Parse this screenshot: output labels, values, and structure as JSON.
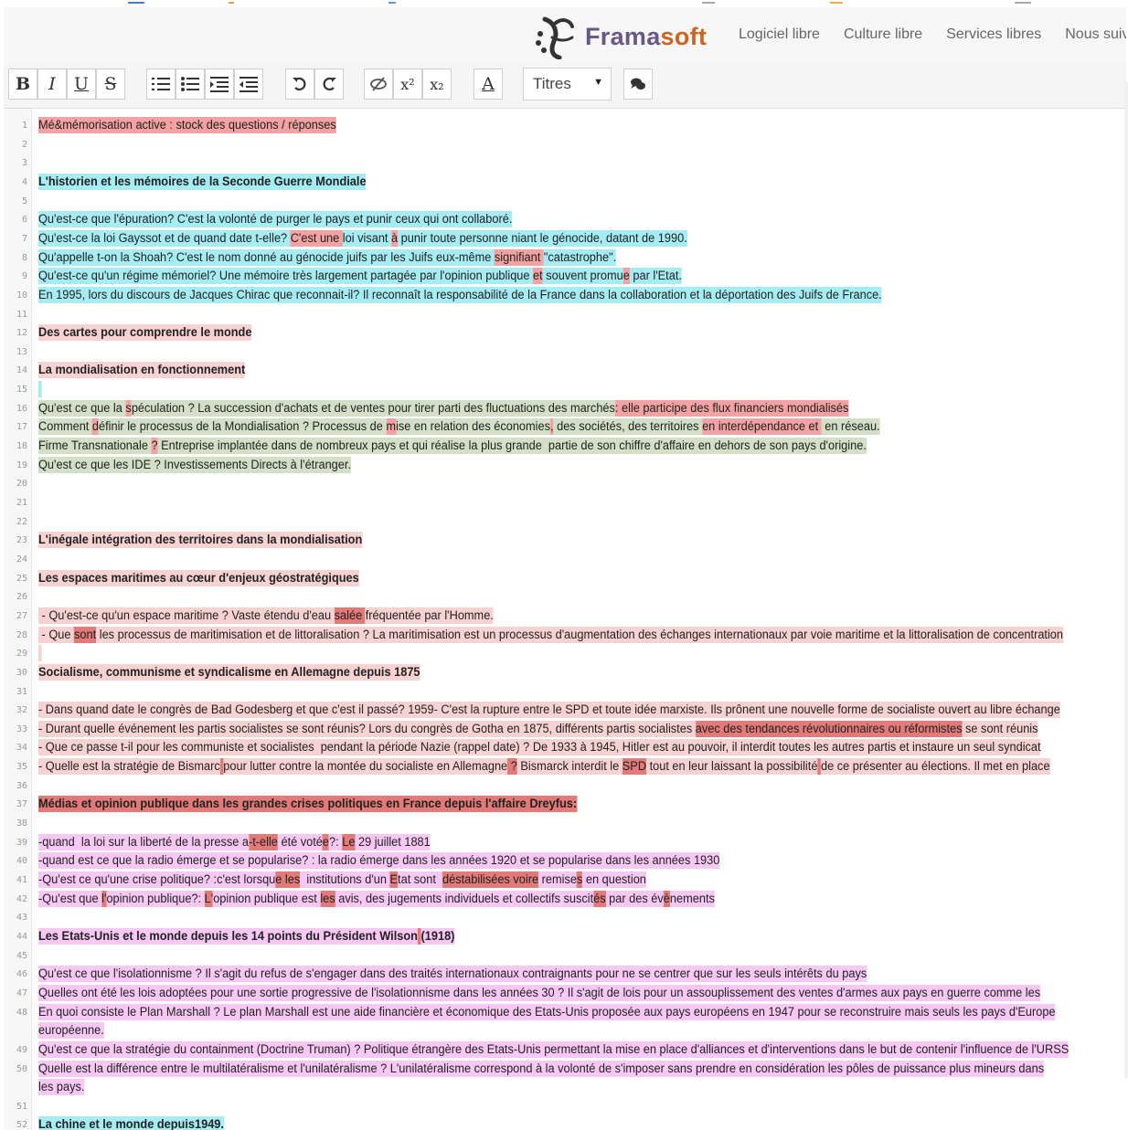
{
  "colors": {
    "blue": "#a6ecf3",
    "red": "#f2a2a2",
    "darkred": "#e27a7a",
    "green": "#d3dfc6",
    "lightpink": "#f7d2d2",
    "pink": "#f6c8f3",
    "accent_purple": "#6a5687",
    "accent_orange": "#cc6520"
  },
  "header": {
    "brand_part1": "Frama",
    "brand_part2": "soft",
    "logo_icon": "framasoft-logo-icon",
    "nav": [
      "Logiciel libre",
      "Culture libre",
      "Services libres",
      "Nous suivre"
    ]
  },
  "toolbar": {
    "buttons": [
      "B",
      "I",
      "U",
      "S",
      "ordered-list",
      "bullet-list",
      "indent",
      "outdent",
      "undo",
      "redo",
      "clear-format",
      "x²",
      "x₂",
      "A"
    ],
    "select_value": "Titres",
    "chat_icon": "chat-icon"
  },
  "lines": [
    {
      "n": "1",
      "segs": [
        {
          "t": "Mé&mémorisation active : stock des questions / réponses",
          "c": "red"
        }
      ]
    },
    {
      "n": "2",
      "segs": []
    },
    {
      "n": "3",
      "segs": []
    },
    {
      "n": "4",
      "segs": [
        {
          "t": "L'historien et les mémoires de la Seconde Guerre Mondiale",
          "c": "blue",
          "b": true
        }
      ]
    },
    {
      "n": "5",
      "segs": []
    },
    {
      "n": "6",
      "segs": [
        {
          "t": "Qu'est-ce que l'épuration? C'est la volonté de purger le pays et punir ceux qui ont collaboré.",
          "c": "blue"
        }
      ]
    },
    {
      "n": "7",
      "segs": [
        {
          "t": "Qu'est-ce la loi Gayssot et de quand date t-elle? ",
          "c": "blue"
        },
        {
          "t": "C'est une ",
          "c": "red"
        },
        {
          "t": "loi visant ",
          "c": "blue"
        },
        {
          "t": "à",
          "c": "red"
        },
        {
          "t": " punir toute personne niant le génocide, datant de 1990.",
          "c": "blue"
        }
      ]
    },
    {
      "n": "8",
      "segs": [
        {
          "t": "Qu'appelle t-on la Shoah? C'est le nom donné au génocide juifs par les Juifs eux-même ",
          "c": "blue"
        },
        {
          "t": "signifiant ",
          "c": "red"
        },
        {
          "t": "\"catastrophe\".",
          "c": "blue"
        }
      ]
    },
    {
      "n": "9",
      "segs": [
        {
          "t": "Qu'est-ce qu'un régime mémoriel? Une mémoire très largement partagée par l'opinion publique ",
          "c": "blue"
        },
        {
          "t": "et",
          "c": "red"
        },
        {
          "t": " souvent promu",
          "c": "blue"
        },
        {
          "t": "e",
          "c": "red"
        },
        {
          "t": " par l'Etat.",
          "c": "blue"
        }
      ]
    },
    {
      "n": "10",
      "segs": [
        {
          "t": "En 1995, lors du discours de Jacques Chirac que reconnait-il? Il reconnaît la responsabilité de la France dans la collaboration et la déportation des Juifs de France.",
          "c": "blue"
        }
      ]
    },
    {
      "n": "11",
      "segs": []
    },
    {
      "n": "12",
      "segs": [
        {
          "t": "Des cartes pour comprendre le monde",
          "c": "lightpink",
          "b": true
        }
      ]
    },
    {
      "n": "13",
      "segs": []
    },
    {
      "n": "14",
      "segs": [
        {
          "t": "La mondialisation en fonctionnement",
          "c": "lightpink",
          "b": true
        }
      ]
    },
    {
      "n": "15",
      "segs": [
        {
          "t": " ",
          "c": "blue"
        }
      ]
    },
    {
      "n": "16",
      "segs": [
        {
          "t": "Qu'est ce que la ",
          "c": "green"
        },
        {
          "t": "s",
          "c": "red"
        },
        {
          "t": "péculation ? La succession d'achats et de ventes pour tirer parti des fluctuations des marchés",
          "c": "green"
        },
        {
          "t": ": elle participe des flux financiers mondialisés",
          "c": "red"
        }
      ]
    },
    {
      "n": "17",
      "segs": [
        {
          "t": "Comment ",
          "c": "green"
        },
        {
          "t": "d",
          "c": "red"
        },
        {
          "t": "éfinir le processus de la Mondialisation ? Processus de ",
          "c": "green"
        },
        {
          "t": "m",
          "c": "red"
        },
        {
          "t": "ise en relation des économies",
          "c": "green"
        },
        {
          "t": ",",
          "c": "red"
        },
        {
          "t": " des sociétés, des territoires ",
          "c": "green"
        },
        {
          "t": "en interdépendance et ",
          "c": "red"
        },
        {
          "t": " en réseau.",
          "c": "green"
        }
      ]
    },
    {
      "n": "18",
      "segs": [
        {
          "t": "Firme Transnationale ",
          "c": "green"
        },
        {
          "t": "?",
          "c": "red"
        },
        {
          "t": " Entreprise implantée dans de nombreux pays et qui réalise la plus grande  partie de son chiffre d'affaire en dehors de son pays d'origine.",
          "c": "green"
        }
      ]
    },
    {
      "n": "19",
      "segs": [
        {
          "t": "Qu'est ce que les IDE ? Investissements Directs à l'étranger.",
          "c": "green"
        }
      ]
    },
    {
      "n": "20",
      "segs": []
    },
    {
      "n": "21",
      "segs": []
    },
    {
      "n": "22",
      "segs": []
    },
    {
      "n": "23",
      "segs": [
        {
          "t": "L'inégale intégration des territoires dans la mondialisation",
          "c": "lightpink",
          "b": true
        }
      ]
    },
    {
      "n": "24",
      "segs": []
    },
    {
      "n": "25",
      "segs": [
        {
          "t": "Les espaces maritimes au cœur d'enjeux géostratégiques",
          "c": "lightpink",
          "b": true
        }
      ]
    },
    {
      "n": "26",
      "segs": []
    },
    {
      "n": "27",
      "segs": [
        {
          "t": " - Qu'est-ce qu'un espace maritime ? Vaste étendu d'eau ",
          "c": "lightpink"
        },
        {
          "t": "salée ",
          "c": "darkred"
        },
        {
          "t": "fréquentée par l'Homme.",
          "c": "lightpink"
        }
      ]
    },
    {
      "n": "28",
      "segs": [
        {
          "t": " - Que ",
          "c": "lightpink"
        },
        {
          "t": "sont",
          "c": "darkred"
        },
        {
          "t": " les processus de maritimisation et de littoralisation ? La maritimisation est un processus d'augmentation des échanges internationaux par voie maritime et la littoralisation de concentration",
          "c": "lightpink"
        }
      ]
    },
    {
      "n": "29",
      "segs": [
        {
          "t": " ",
          "c": "lightpink"
        }
      ]
    },
    {
      "n": "30",
      "segs": [
        {
          "t": "Socialisme, communisme et syndicalisme en Allemagne depuis 1875",
          "c": "lightpink",
          "b": true
        }
      ]
    },
    {
      "n": "31",
      "segs": []
    },
    {
      "n": "32",
      "segs": [
        {
          "t": "- Dans quand date le congrès de Bad Godesberg et que c'est il passé? 1959- C'est la rupture entre le SPD et toute idée marxiste. Ils prônent une nouvelle forme de socialiste ouvert au libre échange",
          "c": "lightpink"
        }
      ]
    },
    {
      "n": "33",
      "segs": [
        {
          "t": "- Durant quelle événement les partis socialistes se sont réunis? Lors du congrès de Gotha en 1875, différents partis socialistes ",
          "c": "lightpink"
        },
        {
          "t": "avec des tendances révolutionnaires ou réformistes",
          "c": "darkred"
        },
        {
          "t": " se sont réunis",
          "c": "lightpink"
        }
      ]
    },
    {
      "n": "34",
      "segs": [
        {
          "t": "- Que ce passe t-il pour les communiste et socialistes  pendant la période Nazie (rappel date) ? De 1933 à 1945, Hitler est au pouvoir, il interdit toutes les autres partis et instaure un seul syndicat",
          "c": "lightpink"
        }
      ]
    },
    {
      "n": "35",
      "segs": [
        {
          "t": "- Quelle est la stratégie de Bismarc",
          "c": "lightpink"
        },
        {
          "t": " ",
          "c": "darkred"
        },
        {
          "t": "pour lutter contre la montée du socialiste en Allemagne",
          "c": "lightpink"
        },
        {
          "t": " ?",
          "c": "darkred"
        },
        {
          "t": " Bismarck interdit le ",
          "c": "lightpink"
        },
        {
          "t": "SPD",
          "c": "darkred"
        },
        {
          "t": " tout en leur laissant la possibilité",
          "c": "lightpink"
        },
        {
          "t": " ",
          "c": "darkred"
        },
        {
          "t": "de ce présenter au élections. Il met en place",
          "c": "lightpink"
        }
      ]
    },
    {
      "n": "36",
      "segs": []
    },
    {
      "n": "37",
      "segs": [
        {
          "t": "Médias et opinion publique dans les grandes crises politiques en France depuis l'affaire Dreyfus:",
          "c": "darkred",
          "b": true
        }
      ]
    },
    {
      "n": "38",
      "segs": []
    },
    {
      "n": "39",
      "segs": [
        {
          "t": "-quand  la loi sur la liberté de la presse ",
          "c": "pink"
        },
        {
          "t": "a",
          "c": "pink"
        },
        {
          "t": "-t-elle",
          "c": "darkred"
        },
        {
          "t": " été voté",
          "c": "pink"
        },
        {
          "t": "e",
          "c": "darkred"
        },
        {
          "t": "?: ",
          "c": "pink"
        },
        {
          "t": "Le",
          "c": "darkred"
        },
        {
          "t": " 29 juillet 1881",
          "c": "pink"
        }
      ]
    },
    {
      "n": "40",
      "segs": [
        {
          "t": "-quand est ce que la radio émerge et se popularise? : la radio émerge dans les années 1920 et se popularise dans les années 1930",
          "c": "pink"
        }
      ]
    },
    {
      "n": "41",
      "segs": [
        {
          "t": "-Qu'est ce qu'une crise politique? :c'est lorsqu",
          "c": "pink"
        },
        {
          "t": "e les",
          "c": "darkred"
        },
        {
          "t": "  institutions d'un ",
          "c": "pink"
        },
        {
          "t": "E",
          "c": "darkred"
        },
        {
          "t": "tat sont  ",
          "c": "pink"
        },
        {
          "t": "déstabilisées voire",
          "c": "darkred"
        },
        {
          "t": " remise",
          "c": "pink"
        },
        {
          "t": "s",
          "c": "darkred"
        },
        {
          "t": " en question",
          "c": "pink"
        }
      ]
    },
    {
      "n": "42",
      "segs": [
        {
          "t": "-Qu'est que ",
          "c": "pink"
        },
        {
          "t": "l'",
          "c": "darkred"
        },
        {
          "t": "opinion publique?: ",
          "c": "pink"
        },
        {
          "t": "L'",
          "c": "darkred"
        },
        {
          "t": "opinion publique est ",
          "c": "pink"
        },
        {
          "t": "les",
          "c": "darkred"
        },
        {
          "t": " avis, des jugements individuels et collectifs suscit",
          "c": "pink"
        },
        {
          "t": "és",
          "c": "darkred"
        },
        {
          "t": " par des év",
          "c": "pink"
        },
        {
          "t": "è",
          "c": "darkred"
        },
        {
          "t": "nements",
          "c": "pink"
        }
      ]
    },
    {
      "n": "43",
      "segs": []
    },
    {
      "n": "44",
      "segs": [
        {
          "t": "Les Etats-Unis et le monde depuis les 14 points du Président Wilson",
          "c": "pink",
          "b": true
        },
        {
          "t": " ",
          "c": "darkred",
          "b": true
        },
        {
          "t": "(1918)",
          "c": "pink",
          "b": true
        }
      ]
    },
    {
      "n": "45",
      "segs": []
    },
    {
      "n": "46",
      "segs": [
        {
          "t": "Qu'est ce que l'isolationnisme ? Il s'agit du refus de s'engager dans des traités internationaux contraignants pour ne se centrer que sur les seuls intérêts du pays",
          "c": "pink"
        }
      ]
    },
    {
      "n": "47",
      "segs": [
        {
          "t": "Quelles ont été les lois adoptées pour une sortie progressive de l'isolationnisme dans les années 30 ? Il s'agit de lois pour un assouplissement des ventes d'armes aux pays en guerre comme les",
          "c": "pink"
        }
      ]
    },
    {
      "n": "48",
      "segs": [
        {
          "t": "En quoi consiste le Plan Marshall ? Le plan Marshall est une aide financière et économique des Etats-Unis proposée aux pays européens en 1947 pour se reconstruire mais seuls les pays d'Europe",
          "c": "pink"
        }
      ]
    },
    {
      "n": "",
      "segs": [
        {
          "t": "européenne.",
          "c": "pink"
        }
      ]
    },
    {
      "n": "49",
      "segs": [
        {
          "t": "Qu'est ce que la stratégie du containment (Doctrine Truman) ? Politique étrangère des Etats-Unis permettant la mise en place d'alliances et d'interventions dans le but de contenir l'influence de l'URSS",
          "c": "pink"
        }
      ]
    },
    {
      "n": "50",
      "segs": [
        {
          "t": "Quelle est la différence entre le multilatéralisme et l'unilatéralisme ? L'unilatéralisme correspond à la volonté de s'imposer sans prendre en considération les pôles de puissance plus mineurs dans",
          "c": "pink"
        }
      ]
    },
    {
      "n": "",
      "segs": [
        {
          "t": "les pays.",
          "c": "pink"
        }
      ]
    },
    {
      "n": "51",
      "segs": []
    },
    {
      "n": "52",
      "segs": [
        {
          "t": "La chine et le monde depuis1949.",
          "c": "blue",
          "b": true
        }
      ]
    }
  ]
}
